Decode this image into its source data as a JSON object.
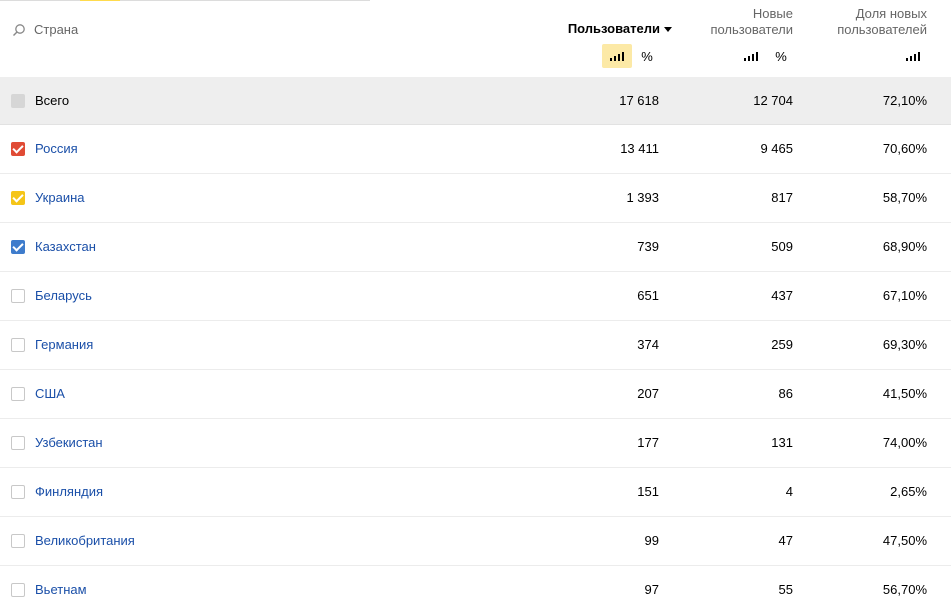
{
  "header": {
    "search_label": "Страна",
    "col_users": "Пользователи",
    "col_new_line1": "Новые",
    "col_new_line2": "пользователи",
    "col_share_line1": "Доля новых",
    "col_share_line2": "пользователей",
    "percent_symbol": "%"
  },
  "colors": {
    "checkbox_red": "#e04b35",
    "checkbox_yellow": "#f5c518",
    "checkbox_blue": "#3e7ccc",
    "active_view_bg": "#fce9a6",
    "link": "#1a4fa8"
  },
  "total": {
    "name": "Всего",
    "users": "17 618",
    "new_users": "12 704",
    "share": "72,10%"
  },
  "rows": [
    {
      "name": "Россия",
      "users": "13 411",
      "new_users": "9 465",
      "share": "70,60%",
      "checked": "red"
    },
    {
      "name": "Украина",
      "users": "1 393",
      "new_users": "817",
      "share": "58,70%",
      "checked": "yellow"
    },
    {
      "name": "Казахстан",
      "users": "739",
      "new_users": "509",
      "share": "68,90%",
      "checked": "blue"
    },
    {
      "name": "Беларусь",
      "users": "651",
      "new_users": "437",
      "share": "67,10%",
      "checked": "none"
    },
    {
      "name": "Германия",
      "users": "374",
      "new_users": "259",
      "share": "69,30%",
      "checked": "none"
    },
    {
      "name": "США",
      "users": "207",
      "new_users": "86",
      "share": "41,50%",
      "checked": "none"
    },
    {
      "name": "Узбекистан",
      "users": "177",
      "new_users": "131",
      "share": "74,00%",
      "checked": "none"
    },
    {
      "name": "Финляндия",
      "users": "151",
      "new_users": "4",
      "share": "2,65%",
      "checked": "none"
    },
    {
      "name": "Великобритания",
      "users": "99",
      "new_users": "47",
      "share": "47,50%",
      "checked": "none"
    },
    {
      "name": "Вьетнам",
      "users": "97",
      "new_users": "55",
      "share": "56,70%",
      "checked": "none"
    }
  ]
}
